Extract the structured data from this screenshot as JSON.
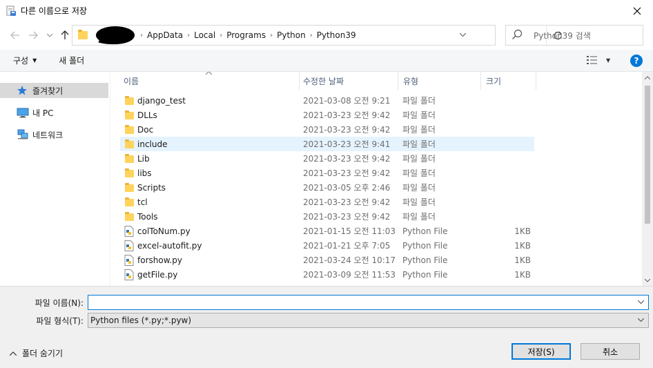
{
  "window": {
    "title": "다른 이름으로 저장"
  },
  "address": {
    "crumbs": [
      "AppData",
      "Local",
      "Programs",
      "Python",
      "Python39"
    ]
  },
  "search": {
    "placeholder": "Python39 검색"
  },
  "toolbar": {
    "organize": "구성",
    "new_folder": "새 폴더"
  },
  "nav": {
    "items": [
      {
        "label": "즐겨찾기",
        "icon": "star-icon"
      },
      {
        "label": "내 PC",
        "icon": "computer-icon"
      },
      {
        "label": "네트워크",
        "icon": "network-icon"
      }
    ]
  },
  "columns": {
    "name": "이름",
    "date": "수정한 날짜",
    "type": "유형",
    "size": "크기"
  },
  "files": [
    {
      "name": "django_test",
      "date": "2021-03-08 오전 9:21",
      "type": "파일 폴더",
      "size": "",
      "kind": "folder"
    },
    {
      "name": "DLLs",
      "date": "2021-03-23 오전 9:42",
      "type": "파일 폴더",
      "size": "",
      "kind": "folder"
    },
    {
      "name": "Doc",
      "date": "2021-03-23 오전 9:42",
      "type": "파일 폴더",
      "size": "",
      "kind": "folder"
    },
    {
      "name": "include",
      "date": "2021-03-23 오전 9:41",
      "type": "파일 폴더",
      "size": "",
      "kind": "folder"
    },
    {
      "name": "Lib",
      "date": "2021-03-23 오전 9:42",
      "type": "파일 폴더",
      "size": "",
      "kind": "folder"
    },
    {
      "name": "libs",
      "date": "2021-03-23 오전 9:42",
      "type": "파일 폴더",
      "size": "",
      "kind": "folder"
    },
    {
      "name": "Scripts",
      "date": "2021-03-05 오후 2:46",
      "type": "파일 폴더",
      "size": "",
      "kind": "folder"
    },
    {
      "name": "tcl",
      "date": "2021-03-23 오전 9:42",
      "type": "파일 폴더",
      "size": "",
      "kind": "folder"
    },
    {
      "name": "Tools",
      "date": "2021-03-23 오전 9:42",
      "type": "파일 폴더",
      "size": "",
      "kind": "folder"
    },
    {
      "name": "colToNum.py",
      "date": "2021-01-15 오전 11:03",
      "type": "Python File",
      "size": "1KB",
      "kind": "py"
    },
    {
      "name": "excel-autofit.py",
      "date": "2021-01-21 오후 7:05",
      "type": "Python File",
      "size": "1KB",
      "kind": "py"
    },
    {
      "name": "forshow.py",
      "date": "2021-03-24 오전 10:17",
      "type": "Python File",
      "size": "1KB",
      "kind": "py"
    },
    {
      "name": "getFile.py",
      "date": "2021-03-09 오전 11:53",
      "type": "Python File",
      "size": "1KB",
      "kind": "py"
    }
  ],
  "form": {
    "filename_label": "파일 이름(N):",
    "filename_value": "",
    "filetype_label": "파일 형식(T):",
    "filetype_value": "Python files (*.py;*.pyw)"
  },
  "footer": {
    "hide_folders": "폴더 숨기기",
    "save": "저장(S)",
    "cancel": "취소"
  }
}
